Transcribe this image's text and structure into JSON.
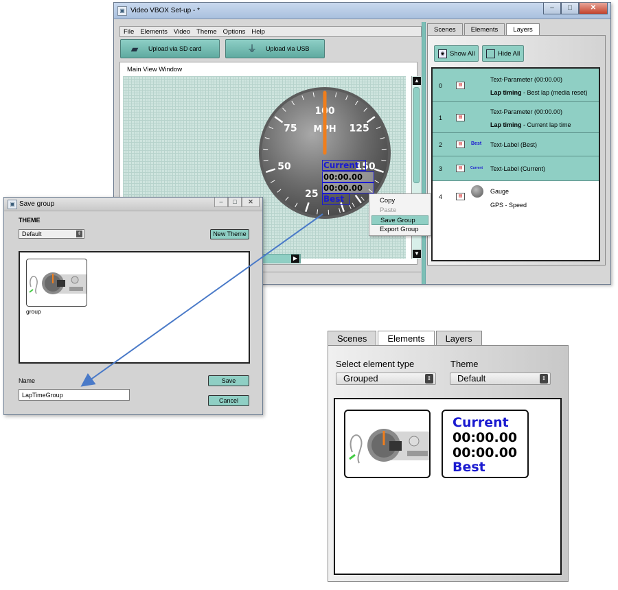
{
  "main_window": {
    "title": "Video VBOX Set-up - *",
    "window_buttons": [
      "‒",
      "□",
      "✕"
    ],
    "menu": [
      "File",
      "Elements",
      "Video",
      "Theme",
      "Options",
      "Help"
    ],
    "toolbar": {
      "upload_sd": "Upload via SD card",
      "upload_usb": "Upload via USB"
    },
    "main_view_label": "Main View Window",
    "gauge": {
      "ticks": [
        {
          "label": "25",
          "value": 25
        },
        {
          "label": "50",
          "value": 50
        },
        {
          "label": "75",
          "value": 75
        },
        {
          "label": "100",
          "value": 100
        },
        {
          "label": "125",
          "value": 125
        },
        {
          "label": "150",
          "value": 150
        }
      ],
      "unit": "MPH",
      "needle_value": 100,
      "needle_color": "#f07e1c"
    },
    "overlay": {
      "current": "Current",
      "time1": "00:00.00",
      "time2": "00:00.00",
      "best": "Best"
    },
    "context_menu": [
      "Copy",
      "Paste",
      "Save Group",
      "Export Group"
    ],
    "tabs": [
      "Scenes",
      "Elements",
      "Layers"
    ],
    "active_tab": "Layers",
    "show_all": "Show All",
    "hide_all": "Hide All",
    "layers": [
      {
        "index": "0",
        "line1": "Text-Parameter (00:00.00)",
        "line2_bold": "Lap timing",
        "line2_rest": " - Best lap (media reset)"
      },
      {
        "index": "1",
        "line1": "Text-Parameter (00:00.00)",
        "line2_bold": "Lap timing",
        "line2_rest": " - Current lap time"
      },
      {
        "index": "2",
        "line1": "Text-Label (Best)",
        "preview": "Best"
      },
      {
        "index": "3",
        "line1": "Text-Label (Current)",
        "preview": "Current"
      },
      {
        "index": "4",
        "line1": "Gauge",
        "line2": "GPS - Speed"
      }
    ]
  },
  "save_dialog": {
    "title": "Save group",
    "window_buttons": [
      "‒",
      "□",
      "✕"
    ],
    "theme_label": "THEME",
    "theme_value": "Default",
    "new_theme": "New Theme",
    "thumb_caption": "group",
    "name_label": "Name",
    "name_value": "LapTimeGroup",
    "save": "Save",
    "cancel": "Cancel"
  },
  "elements_panel": {
    "tabs": [
      "Scenes",
      "Elements",
      "Layers"
    ],
    "active_tab": "Elements",
    "select_type_label": "Select element type",
    "select_type_value": "Grouped",
    "theme_label": "Theme",
    "theme_value": "Default",
    "text_card": {
      "current": "Current",
      "time1": "00:00.00",
      "time2": "00:00.00",
      "best": "Best"
    }
  },
  "colors": {
    "teal": "#8fcfc4",
    "overlay_blue": "#1a1ad0",
    "arrow_blue": "#4a7ac8"
  }
}
